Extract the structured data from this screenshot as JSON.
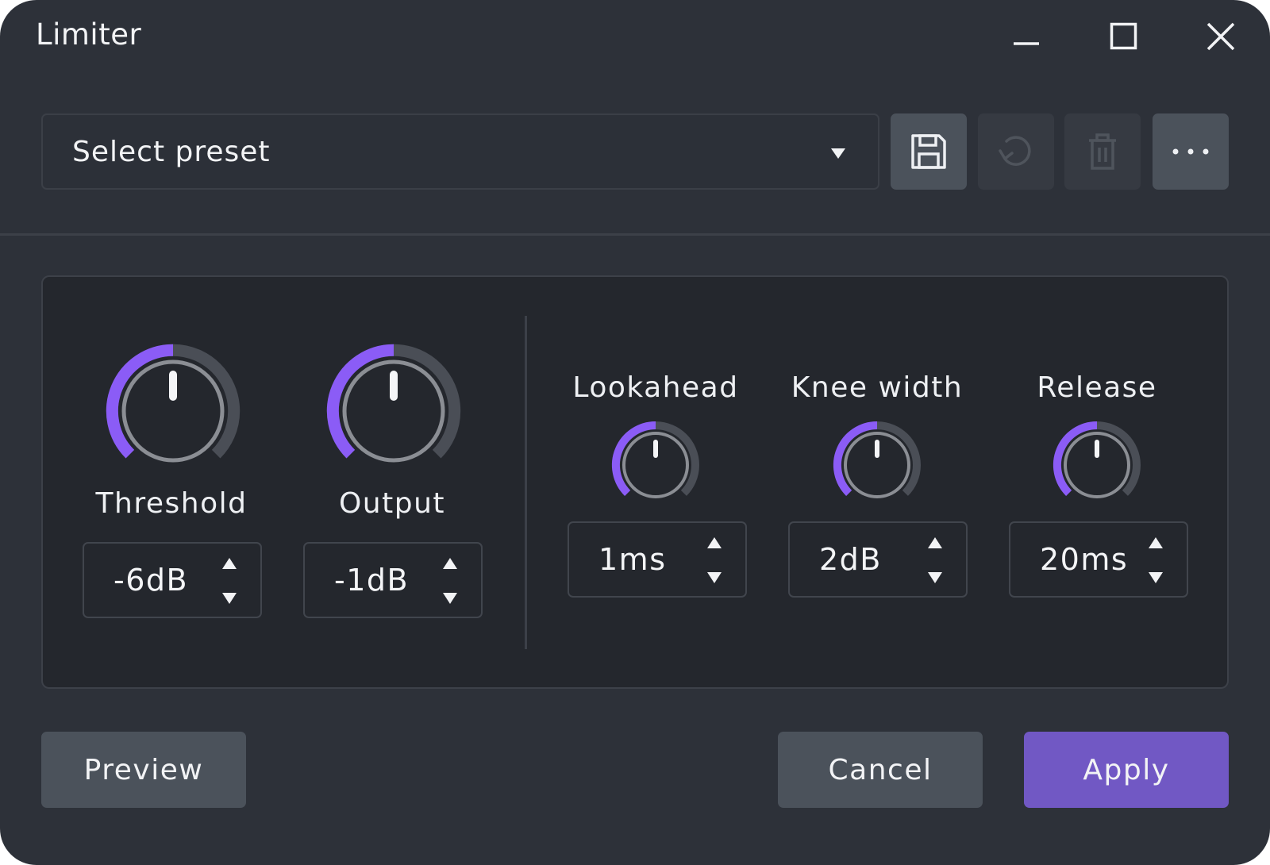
{
  "window": {
    "title": "Limiter"
  },
  "preset": {
    "placeholder": "Select preset",
    "tools": [
      {
        "name": "save",
        "icon": "save-icon",
        "enabled": true
      },
      {
        "name": "undo",
        "icon": "undo-icon",
        "enabled": false
      },
      {
        "name": "delete",
        "icon": "trash-icon",
        "enabled": false
      },
      {
        "name": "more",
        "icon": "more-icon",
        "enabled": true
      }
    ]
  },
  "controls": {
    "threshold": {
      "label": "Threshold",
      "value": "-6dB"
    },
    "output": {
      "label": "Output",
      "value": "-1dB"
    },
    "lookahead": {
      "label": "Lookahead",
      "value": "1ms"
    },
    "knee": {
      "label": "Knee width",
      "value": "2dB"
    },
    "release": {
      "label": "Release",
      "value": "20ms"
    }
  },
  "footer": {
    "preview_label": "Preview",
    "cancel_label": "Cancel",
    "apply_label": "Apply"
  },
  "colors": {
    "window_bg": "#2d3139",
    "panel_bg": "#24272d",
    "accent": "#8b5cf6",
    "primary_button": "#7158c4",
    "gray_button": "#4b525b"
  }
}
